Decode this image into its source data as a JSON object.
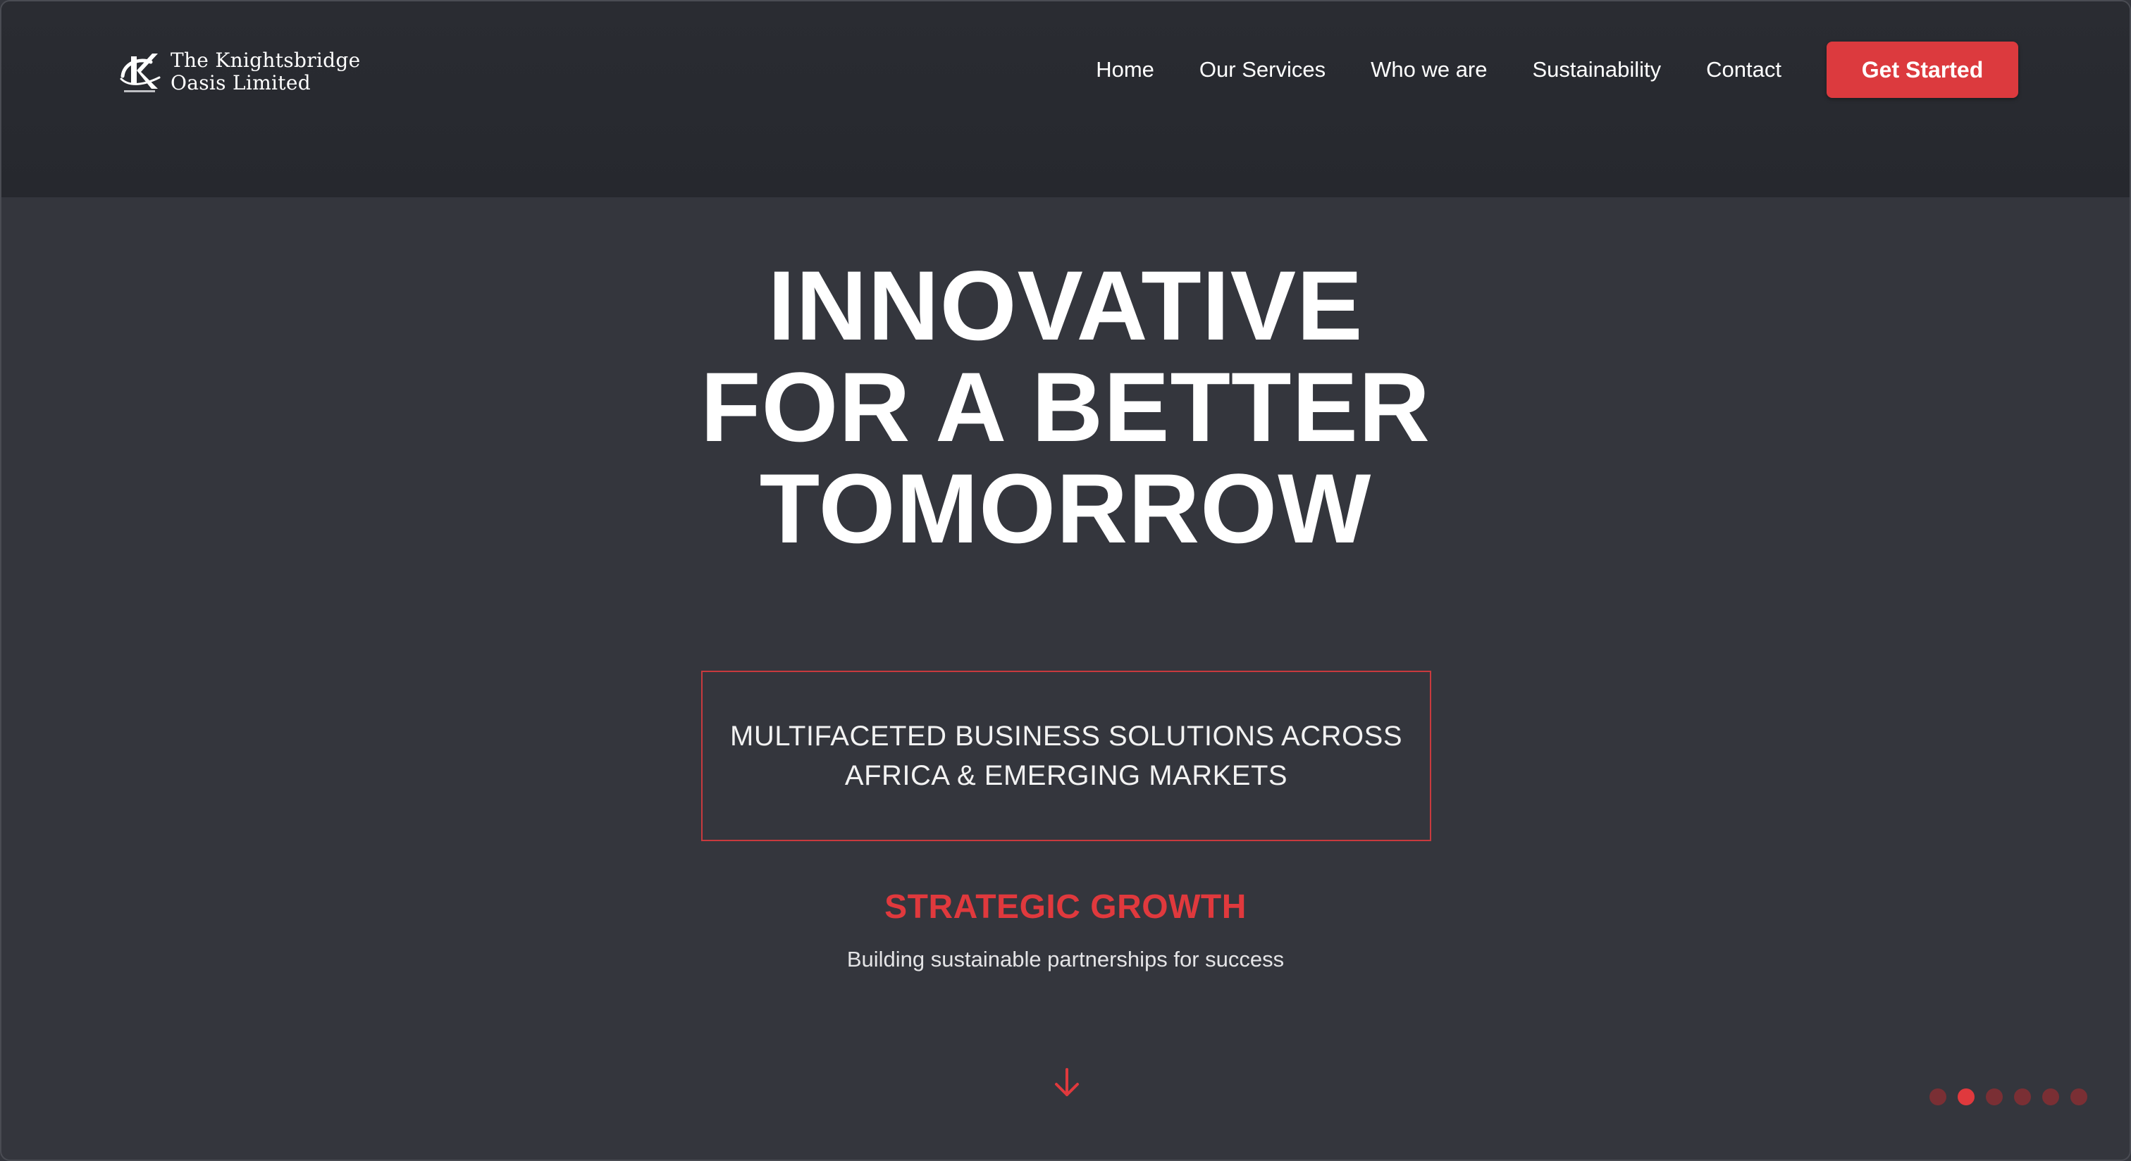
{
  "brand": {
    "name_line1": "The Knightsbridge",
    "name_line2": "Oasis Limited"
  },
  "nav": {
    "items": [
      {
        "label": "Home"
      },
      {
        "label": "Our Services"
      },
      {
        "label": "Who we are"
      },
      {
        "label": "Sustainability"
      },
      {
        "label": "Contact"
      }
    ],
    "cta_label": "Get Started"
  },
  "hero": {
    "title_lines": [
      "INNOVATIVE",
      "FOR A BETTER",
      "TOMORROW"
    ],
    "tagline_lines": [
      "MULTIFACETED BUSINESS SOLUTIONS ACROSS",
      "AFRICA & EMERGING MARKETS"
    ],
    "subheading": "STRATEGIC GROWTH",
    "subtext": "Building sustainable partnerships for success"
  },
  "slider": {
    "total": 6,
    "active_index": 1
  },
  "icons": {
    "logo": "knightsbridge-k-logo-icon",
    "scroll": "arrow-down-icon"
  },
  "colors": {
    "background": "#34363d",
    "header": "#2a2c32",
    "accent": "#dc3a3e",
    "dot_inactive": "#7a2f34"
  }
}
